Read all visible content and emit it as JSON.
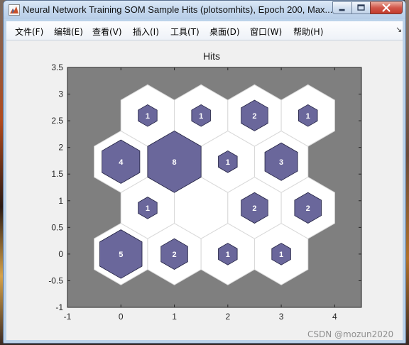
{
  "window": {
    "title": "Neural Network Training SOM Sample Hits (plotsomhits), Epoch 200, Max..."
  },
  "menu": {
    "items": [
      {
        "label": "文件(F)"
      },
      {
        "label": "编辑(E)"
      },
      {
        "label": "查看(V)"
      },
      {
        "label": "插入(I)"
      },
      {
        "label": "工具(T)"
      },
      {
        "label": "桌面(D)"
      },
      {
        "label": "窗口(W)"
      },
      {
        "label": "帮助(H)"
      }
    ],
    "overflow_icon": "chevron-right-icon"
  },
  "chart_data": {
    "type": "heatmap",
    "title": "Hits",
    "xlabel": "",
    "ylabel": "",
    "xlim": [
      -1,
      4.5
    ],
    "ylim": [
      -1,
      3.5
    ],
    "xticks": [
      "-1",
      "0",
      "1",
      "2",
      "3",
      "4"
    ],
    "yticks": [
      "-1",
      "-0.5",
      "0",
      "0.5",
      "1",
      "1.5",
      "2",
      "2.5",
      "3",
      "3.5"
    ],
    "grid": false,
    "max_hits": 8,
    "neurons": [
      {
        "x": 0,
        "y": 0,
        "hits": 5
      },
      {
        "x": 1,
        "y": 0,
        "hits": 2
      },
      {
        "x": 2,
        "y": 0,
        "hits": 1
      },
      {
        "x": 3,
        "y": 0,
        "hits": 1
      },
      {
        "x": 0.5,
        "y": 0.866,
        "hits": 1
      },
      {
        "x": 1.5,
        "y": 0.866,
        "hits": 0
      },
      {
        "x": 2.5,
        "y": 0.866,
        "hits": 2
      },
      {
        "x": 3.5,
        "y": 0.866,
        "hits": 2
      },
      {
        "x": 0,
        "y": 1.732,
        "hits": 4
      },
      {
        "x": 1,
        "y": 1.732,
        "hits": 8
      },
      {
        "x": 2,
        "y": 1.732,
        "hits": 1
      },
      {
        "x": 3,
        "y": 1.732,
        "hits": 3
      },
      {
        "x": 0.5,
        "y": 2.598,
        "hits": 1
      },
      {
        "x": 1.5,
        "y": 2.598,
        "hits": 1
      },
      {
        "x": 2.5,
        "y": 2.598,
        "hits": 2
      },
      {
        "x": 3.5,
        "y": 2.598,
        "hits": 1
      }
    ],
    "colors": {
      "axes_background": "#7f7f7f",
      "cell_fill": "#ffffff",
      "cell_edge": "#d9d9d9",
      "hit_fill": "#6a679b",
      "hit_edge": "#1f1f3f",
      "hit_label": "#ffffff"
    }
  },
  "watermark": "CSDN @mozun2020"
}
